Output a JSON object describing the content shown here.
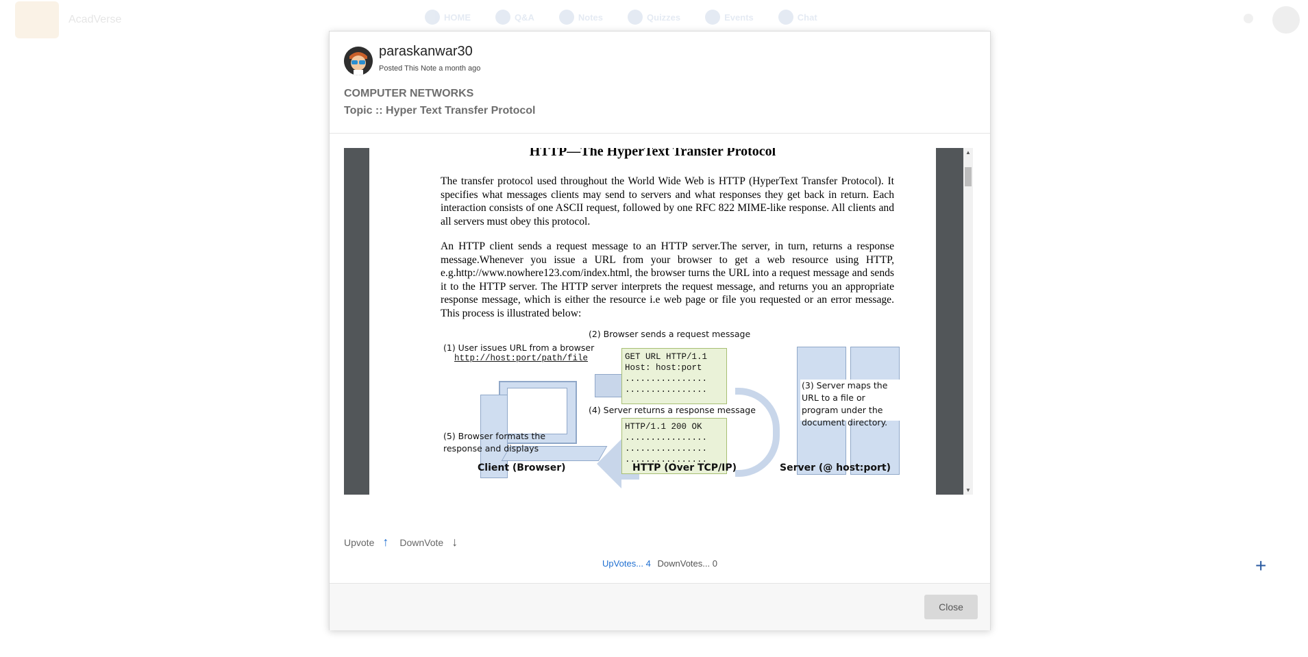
{
  "background": {
    "brand": "AcadVerse",
    "nav": [
      "HOME",
      "Q&A",
      "Notes",
      "Quizzes",
      "Events",
      "Chat"
    ]
  },
  "post": {
    "username": "paraskanwar30",
    "posted": "Posted This Note a month ago",
    "subject": "COMPUTER NETWORKS",
    "topic": "Topic :: Hyper Text Transfer Protocol"
  },
  "document": {
    "title": "HTTP—The HyperText Transfer Protocol",
    "para1": "The transfer protocol used throughout the World Wide Web is HTTP (HyperText Transfer Protocol). It specifies what messages clients may send to servers and what responses they get back in return. Each interaction consists of one ASCII request, followed by one RFC 822 MIME-like response. All clients and all servers must obey this protocol.",
    "para2": "An HTTP client sends a request message to an HTTP server.The server, in turn, returns a response message.Whenever you issue a URL from your browser to get a web resource using HTTP, e.g.http://www.nowhere123.com/index.html, the browser turns the URL into a request message and sends it to the HTTP server. The HTTP server interprets the request message, and returns you an appropriate response message, which is either the resource i.e web page or file  you requested or an error message. This process is illustrated below:",
    "diagram": {
      "step1": "(1) User issues URL from a browser",
      "step1_url": "http://host:port/path/file",
      "step2": "(2) Browser sends a request message",
      "request_lines": [
        "GET URL HTTP/1.1",
        "Host: host:port",
        "................",
        "................"
      ],
      "step3": "(3) Server maps the URL to a file or program under the document directory.",
      "step4": "(4) Server returns a response message",
      "response_lines": [
        "HTTP/1.1 200 OK",
        "................",
        "................",
        "................"
      ],
      "step5": "(5) Browser formats the response and displays",
      "client_label": "Client (Browser)",
      "http_label": "HTTP (Over TCP/IP)",
      "server_label": "Server (@ host:port)"
    }
  },
  "votes": {
    "upvote_label": "Upvote",
    "downvote_label": "DownVote",
    "upvotes_text": "UpVotes... 4",
    "downvotes_text": "DownVotes... 0"
  },
  "footer": {
    "close_label": "Close"
  }
}
